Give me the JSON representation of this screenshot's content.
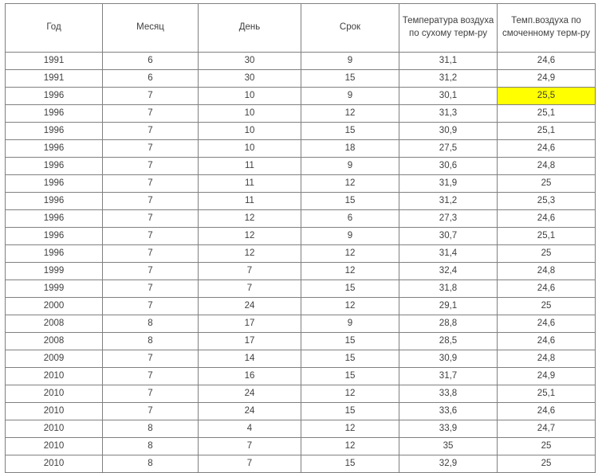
{
  "table": {
    "columns": [
      {
        "key": "year",
        "label": "Год"
      },
      {
        "key": "month",
        "label": "Месяц"
      },
      {
        "key": "day",
        "label": "День"
      },
      {
        "key": "term",
        "label": "Срок"
      },
      {
        "key": "dry",
        "label": "Температура воздуха по сухому терм-ру"
      },
      {
        "key": "wet",
        "label": "Темп.воздуха по смоченному терм-ру"
      }
    ],
    "highlight_color": "#ffff00",
    "border_color": "#808080",
    "text_color": "#404040",
    "rows": [
      {
        "year": "1991",
        "month": "6",
        "day": "30",
        "term": "9",
        "dry": "31,1",
        "wet": "24,6",
        "wet_highlighted": false
      },
      {
        "year": "1991",
        "month": "6",
        "day": "30",
        "term": "15",
        "dry": "31,2",
        "wet": "24,9",
        "wet_highlighted": false
      },
      {
        "year": "1996",
        "month": "7",
        "day": "10",
        "term": "9",
        "dry": "30,1",
        "wet": "25,5",
        "wet_highlighted": true
      },
      {
        "year": "1996",
        "month": "7",
        "day": "10",
        "term": "12",
        "dry": "31,3",
        "wet": "25,1",
        "wet_highlighted": false
      },
      {
        "year": "1996",
        "month": "7",
        "day": "10",
        "term": "15",
        "dry": "30,9",
        "wet": "25,1",
        "wet_highlighted": false
      },
      {
        "year": "1996",
        "month": "7",
        "day": "10",
        "term": "18",
        "dry": "27,5",
        "wet": "24,6",
        "wet_highlighted": false
      },
      {
        "year": "1996",
        "month": "7",
        "day": "11",
        "term": "9",
        "dry": "30,6",
        "wet": "24,8",
        "wet_highlighted": false
      },
      {
        "year": "1996",
        "month": "7",
        "day": "11",
        "term": "12",
        "dry": "31,9",
        "wet": "25",
        "wet_highlighted": false
      },
      {
        "year": "1996",
        "month": "7",
        "day": "11",
        "term": "15",
        "dry": "31,2",
        "wet": "25,3",
        "wet_highlighted": false
      },
      {
        "year": "1996",
        "month": "7",
        "day": "12",
        "term": "6",
        "dry": "27,3",
        "wet": "24,6",
        "wet_highlighted": false
      },
      {
        "year": "1996",
        "month": "7",
        "day": "12",
        "term": "9",
        "dry": "30,7",
        "wet": "25,1",
        "wet_highlighted": false
      },
      {
        "year": "1996",
        "month": "7",
        "day": "12",
        "term": "12",
        "dry": "31,4",
        "wet": "25",
        "wet_highlighted": false
      },
      {
        "year": "1999",
        "month": "7",
        "day": "7",
        "term": "12",
        "dry": "32,4",
        "wet": "24,8",
        "wet_highlighted": false
      },
      {
        "year": "1999",
        "month": "7",
        "day": "7",
        "term": "15",
        "dry": "31,8",
        "wet": "24,6",
        "wet_highlighted": false
      },
      {
        "year": "2000",
        "month": "7",
        "day": "24",
        "term": "12",
        "dry": "29,1",
        "wet": "25",
        "wet_highlighted": false
      },
      {
        "year": "2008",
        "month": "8",
        "day": "17",
        "term": "9",
        "dry": "28,8",
        "wet": "24,6",
        "wet_highlighted": false
      },
      {
        "year": "2008",
        "month": "8",
        "day": "17",
        "term": "15",
        "dry": "28,5",
        "wet": "24,6",
        "wet_highlighted": false
      },
      {
        "year": "2009",
        "month": "7",
        "day": "14",
        "term": "15",
        "dry": "30,9",
        "wet": "24,8",
        "wet_highlighted": false
      },
      {
        "year": "2010",
        "month": "7",
        "day": "16",
        "term": "15",
        "dry": "31,7",
        "wet": "24,9",
        "wet_highlighted": false
      },
      {
        "year": "2010",
        "month": "7",
        "day": "24",
        "term": "12",
        "dry": "33,8",
        "wet": "25,1",
        "wet_highlighted": false
      },
      {
        "year": "2010",
        "month": "7",
        "day": "24",
        "term": "15",
        "dry": "33,6",
        "wet": "24,6",
        "wet_highlighted": false
      },
      {
        "year": "2010",
        "month": "8",
        "day": "4",
        "term": "12",
        "dry": "33,9",
        "wet": "24,7",
        "wet_highlighted": false
      },
      {
        "year": "2010",
        "month": "8",
        "day": "7",
        "term": "12",
        "dry": "35",
        "wet": "25",
        "wet_highlighted": false
      },
      {
        "year": "2010",
        "month": "8",
        "day": "7",
        "term": "15",
        "dry": "32,9",
        "wet": "25",
        "wet_highlighted": false
      }
    ]
  }
}
